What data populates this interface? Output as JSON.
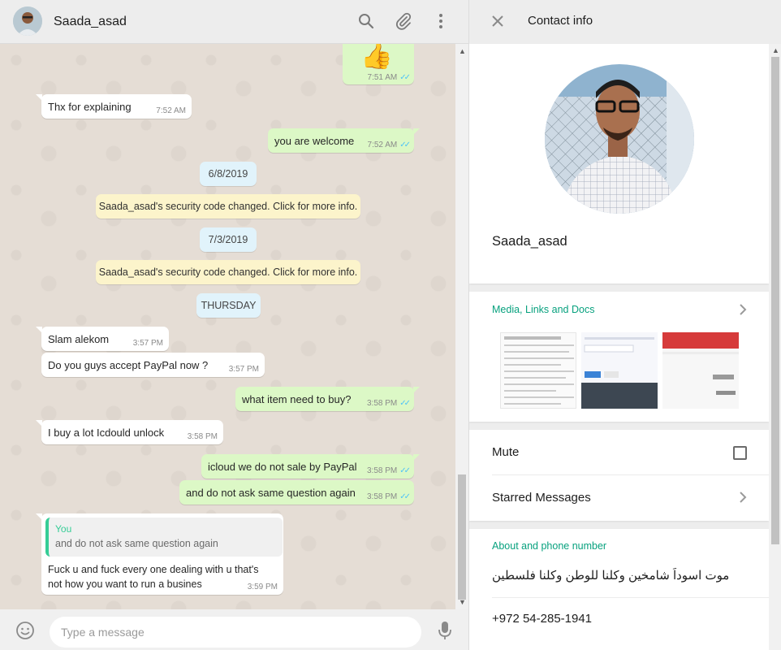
{
  "chat": {
    "contact_name": "Saada_asad",
    "messages": [
      {
        "dir": "out",
        "kind": "emoji",
        "emoji": "👍",
        "time": "7:51 AM",
        "read": true
      },
      {
        "dir": "in",
        "text": "Thx for explaining",
        "time": "7:52 AM"
      },
      {
        "dir": "out",
        "text": "you are welcome",
        "time": "7:52 AM",
        "read": true
      },
      {
        "kind": "date",
        "text": "6/8/2019"
      },
      {
        "kind": "system",
        "text": "Saada_asad's security code changed. Click for more info."
      },
      {
        "kind": "date",
        "text": "7/3/2019"
      },
      {
        "kind": "system",
        "text": "Saada_asad's security code changed. Click for more info."
      },
      {
        "kind": "date",
        "text": "THURSDAY"
      },
      {
        "dir": "in",
        "text": "Slam alekom",
        "time": "3:57 PM"
      },
      {
        "dir": "in",
        "text": "Do you guys accept PayPal now ?",
        "time": "3:57 PM"
      },
      {
        "dir": "out",
        "text": "what item need to buy?",
        "time": "3:58 PM",
        "read": true
      },
      {
        "dir": "in",
        "text": "I buy a lot Icdould unlock",
        "time": "3:58 PM"
      },
      {
        "dir": "out",
        "text": "icloud we do not sale by PayPal",
        "time": "3:58 PM",
        "read": true
      },
      {
        "dir": "out",
        "text": "and do not ask same question again",
        "time": "3:58 PM",
        "read": true
      },
      {
        "dir": "in",
        "kind": "reply",
        "quote_author": "You",
        "quote_text": "and do not ask same question again",
        "line1": "Fuck u and fuck every one dealing with u  that's",
        "line2": "not how you want to run a busines",
        "time": "3:59 PM"
      }
    ],
    "composer": {
      "placeholder": "Type a message"
    }
  },
  "contact_info": {
    "title": "Contact info",
    "name": "Saada_asad",
    "media_title": "Media, Links and Docs",
    "mute_label": "Mute",
    "mute_checked": false,
    "starred_label": "Starred Messages",
    "about_title": "About and phone number",
    "about_text": "موت اسوداً شامخين وكلنا للوطن وكلنا فلسطين",
    "phone": "+972 54-285-1941"
  },
  "colors": {
    "outgoing_bubble": "#dcf8c6",
    "incoming_bubble": "#ffffff",
    "accent": "#07a17e",
    "read_tick": "#4fc3f7",
    "date_chip": "#e1f3fb",
    "system_chip": "#fcf4cb"
  },
  "icons": [
    "search-icon",
    "attach-icon",
    "menu-icon",
    "close-icon",
    "emoji-icon",
    "mic-icon",
    "chevron-right-icon",
    "checkbox-icon"
  ]
}
